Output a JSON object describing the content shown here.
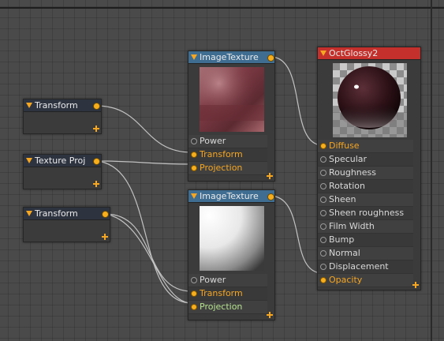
{
  "nodes": {
    "transform1": {
      "title": "Transform"
    },
    "texture_proj": {
      "title": "Texture Proj"
    },
    "transform2": {
      "title": "Transform"
    },
    "image_texture1": {
      "title": "ImageTexture",
      "pins": [
        {
          "label": "Power",
          "connected": false
        },
        {
          "label": "Transform",
          "connected": true
        },
        {
          "label": "Projection",
          "connected": true
        }
      ]
    },
    "image_texture2": {
      "title": "ImageTexture",
      "pins": [
        {
          "label": "Power",
          "connected": false
        },
        {
          "label": "Transform",
          "connected": true
        },
        {
          "label": "Projection",
          "connected": true
        }
      ]
    },
    "oct_glossy": {
      "title": "OctGlossy2",
      "pins": [
        "Diffuse",
        "Specular",
        "Roughness",
        "Rotation",
        "Sheen",
        "Sheen roughness",
        "Film Width",
        "Bump",
        "Normal",
        "Displacement",
        "Opacity"
      ]
    }
  },
  "colors": {
    "canvas": "#4a4a4a",
    "node_body": "#3b3b3b",
    "header_dark": "#2d3440",
    "header_blue": "#3e6d91",
    "header_red": "#c4302b",
    "pin_active": "#f7ae1e",
    "label_orange": "#f5a623",
    "label_green": "#b6e38f"
  },
  "icons": {
    "collapse": "triangle-down-icon",
    "resize": "resize-handle-icon",
    "pin": "socket-pin-icon"
  }
}
